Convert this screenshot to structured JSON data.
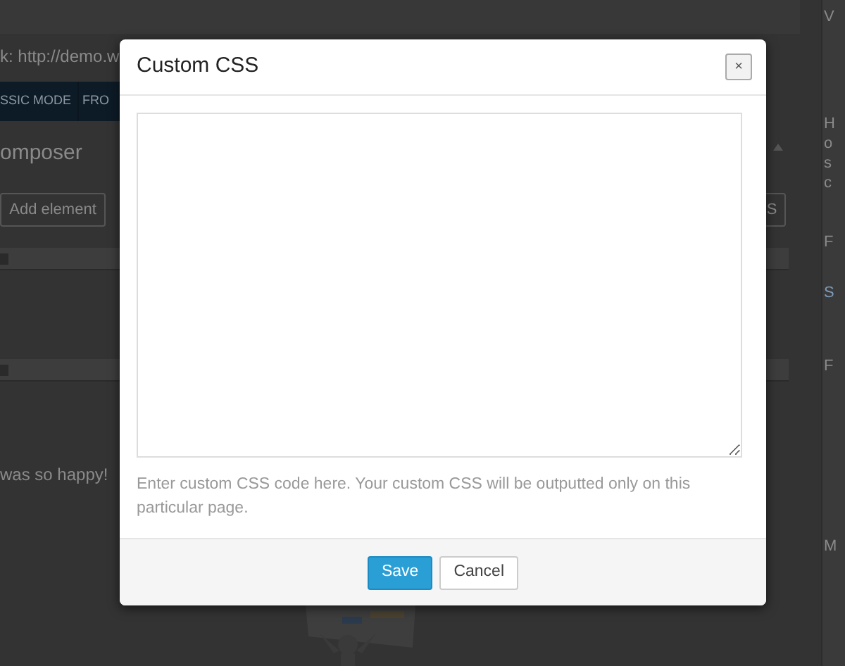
{
  "background": {
    "permalink": "k: http://demo.w",
    "mode_tabs": [
      {
        "label": "SSIC MODE"
      },
      {
        "label": "FRO"
      }
    ],
    "panel_title": "omposer",
    "add_element": "Add element",
    "toolbar_button": "S",
    "content_text": "was so happy!",
    "sidebar_letters": [
      "V",
      "H",
      "o",
      "s",
      "c",
      "F",
      "S",
      "F",
      "M"
    ]
  },
  "dialog": {
    "title": "Custom CSS",
    "close": "×",
    "help": "Enter custom CSS code here. Your custom CSS will be outputted only on this particular page.",
    "buttons": [
      {
        "label": "Save",
        "kind": "primary"
      },
      {
        "label": "Cancel",
        "kind": "secondary"
      }
    ]
  }
}
